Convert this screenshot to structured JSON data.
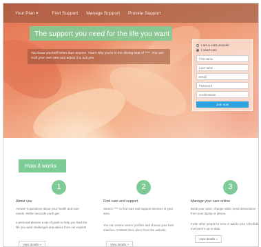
{
  "nav": {
    "items": [
      "Your Plan ▾",
      "Find Support",
      "Manage Support",
      "Provide Support"
    ]
  },
  "hero": {
    "title": "The support you need for the life you want",
    "text": "You know yourself better than anyone. That's why you're in the driving seat of ****. You can craft your own care and adjust it to suit you."
  },
  "signup": {
    "role_options": [
      "I am a care provider",
      "I need care"
    ],
    "selected_role": "I need care",
    "fields": {
      "first_name": "First name",
      "last_name": "Last name",
      "email": "Email",
      "password": "Password",
      "confirmation": "Confirmation"
    },
    "join_label": "Join now"
  },
  "how_it_works": {
    "badge": "How it works",
    "steps": [
      {
        "number": "1",
        "title": "About you",
        "desc": "Answer 5 questions about your health and care needs. Within seconds you'll get:",
        "desc2": "a personal planner a set of goals to help you lead the life you want challenges and advice from our experts",
        "button": "View details »"
      },
      {
        "number": "2",
        "title": "Find care and support",
        "desc": "Search **** to find care and support services in your area.",
        "desc2": "You can review carers' profiles and choose your best matches. Contact them direct from the website.",
        "button": "View details »"
      },
      {
        "number": "3",
        "title": "Manage your care online",
        "desc": "Book your carer, change visits, send instructions - all from your laptop or phone.",
        "desc2": "Invite other people to view or add to your schedule so everyone's up-to-date.",
        "button": "View details »"
      }
    ]
  },
  "colors": {
    "accent_green": "#7dcc95",
    "join_blue": "#2ea2dd"
  }
}
